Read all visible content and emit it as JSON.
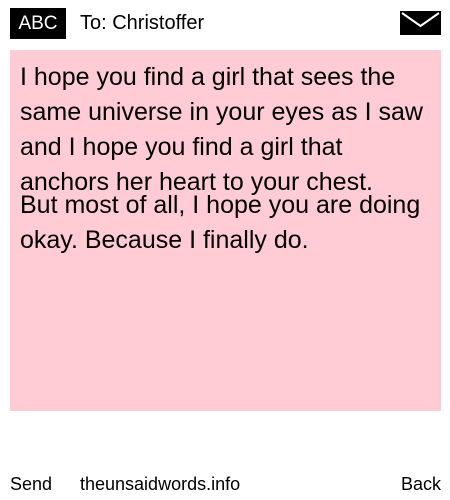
{
  "header": {
    "input_mode_label": "ABC",
    "recipient_line": "To: Christoffer",
    "mail_icon": "envelope-icon"
  },
  "message": {
    "paragraph_1": "I hope you find a girl that sees the same universe in your eyes as I saw and I hope you find a girl that anchors her heart to your chest.",
    "paragraph_2": "But most of all, I hope you are doing okay. Because I finally do."
  },
  "footer": {
    "send_label": "Send",
    "site_label": "theunsaidwords.info",
    "back_label": "Back"
  },
  "colors": {
    "message_background": "#ffccd5",
    "badge_background": "#000000"
  }
}
